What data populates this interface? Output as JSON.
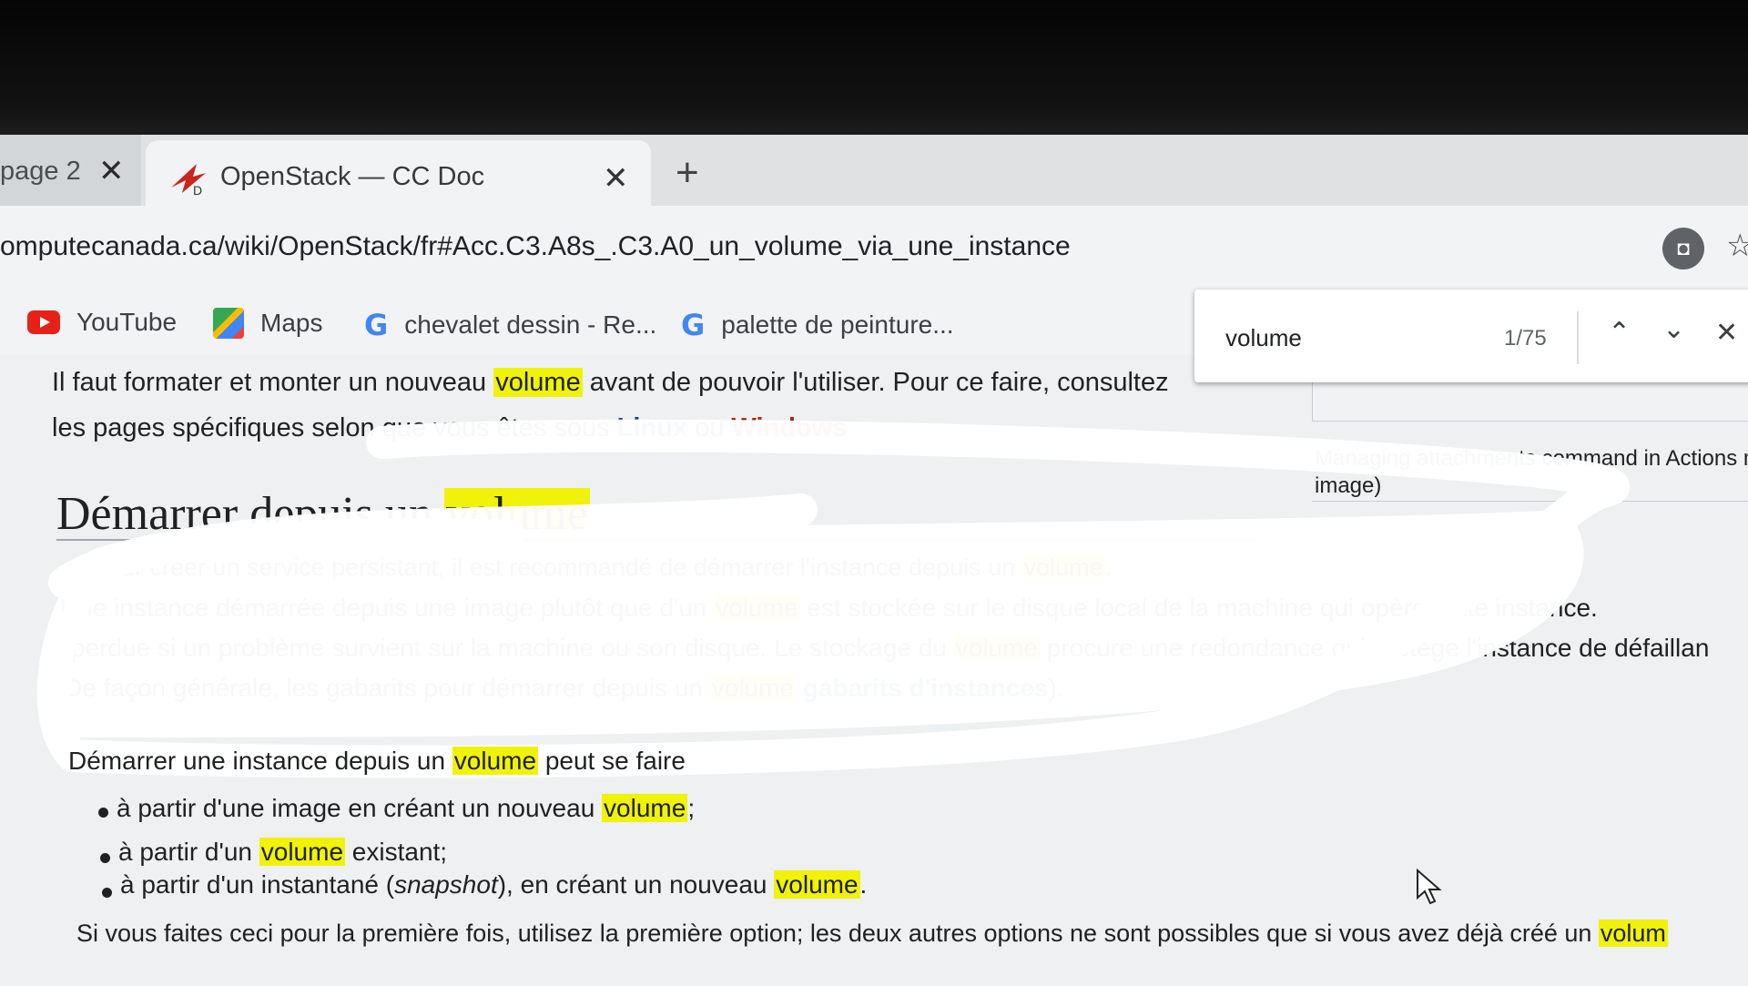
{
  "browser": {
    "tabs": [
      {
        "label": "page 2",
        "active": false
      },
      {
        "label": "OpenStack — CC Doc",
        "active": true
      }
    ],
    "new_tab": "+",
    "close_glyph": "✕",
    "url": "omputecanada.ca/wiki/OpenStack/fr#Acc.C3.A8s_.C3.A0_un_volume_via_une_instance",
    "bookmarks": [
      {
        "label": "YouTube",
        "icon": "youtube-icon"
      },
      {
        "label": "Maps",
        "icon": "maps-icon"
      },
      {
        "label": "chevalet dessin - Re...",
        "icon": "google-icon"
      },
      {
        "label": "palette de peinture...",
        "icon": "google-icon"
      }
    ],
    "find": {
      "query": "volume",
      "count": "1/75"
    }
  },
  "page": {
    "intro_line1": {
      "a": "Il faut formater et monter un nouveau ",
      "hl": "volume",
      "b": " avant de pouvoir l'utiliser. Pour ce faire, consultez"
    },
    "intro_line2": {
      "a": "les pages spécifiques selon que vous êtes sous ",
      "linux": "Linux",
      "mid": " ou ",
      "windows": "Windows"
    },
    "heading": {
      "a": "Démarrer depuis un ",
      "hl": "volume"
    },
    "side_caption": "Managing attachments command in Actions m",
    "side_caption2": "image)",
    "para": [
      {
        "a": "Pour créer un service persistant, il est recommandé de démarrer l'instance depuis un ",
        "hl": "volume",
        "b": "."
      },
      {
        "a": "Une instance démarrée depuis une image plutôt que d'un ",
        "hl": "volume",
        "b": " est stockée sur le disque local de la machine qui opère cette instance."
      },
      {
        "a": "perdue si un problème survient sur la machine ou son disque. Le stockage du ",
        "hl": "volume",
        "b": " procure une redondance qui protège l'instance de défaillan"
      },
      {
        "a": "De façon générale, les gabarits pour démarrer depuis un ",
        "hl": "volume",
        "b": " ",
        "link": "gabarits d'instances",
        "c": ")."
      }
    ],
    "boot_intro": {
      "a": "Démarrer une instance depuis un ",
      "hl": "volume",
      "b": " peut se faire"
    },
    "options": [
      {
        "a": "à partir d'une image en créant un nouveau ",
        "hl": "volume",
        "b": ";"
      },
      {
        "a": "à partir d'un ",
        "hl": "volume",
        "b": " existant;"
      },
      {
        "a": "à partir d'un instantané (",
        "em": "snapshot",
        "b": "), en créant un nouveau ",
        "hl": "volume",
        "c": "."
      }
    ],
    "last_line": {
      "a": "Si vous faites ceci pour la première fois, utilisez la première option; les deux autres options ne sont possibles que si vous avez déjà créé un ",
      "hl": "volum"
    }
  },
  "colors": {
    "highlight": "#f0f20a",
    "link_blue": "#1d3a96",
    "link_red": "#b0230f"
  }
}
